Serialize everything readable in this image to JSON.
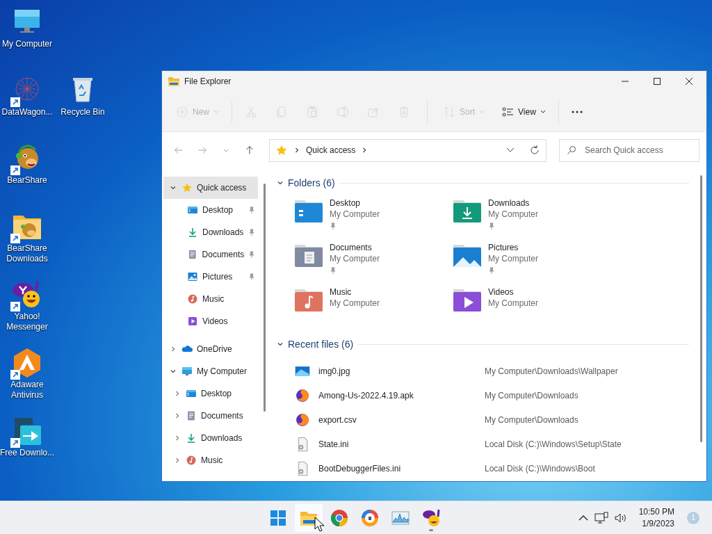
{
  "desktop_icons": [
    {
      "label": "My Computer",
      "kind": "monitor",
      "shortcut": false
    },
    {
      "label": "DataWagon...",
      "kind": "web",
      "shortcut": true
    },
    {
      "label": "Recycle Bin",
      "kind": "recycle",
      "shortcut": false
    },
    {
      "label": "BearShare",
      "kind": "bear",
      "shortcut": true
    },
    {
      "label": "BearShare Downloads",
      "kind": "bearfolder",
      "shortcut": true
    },
    {
      "label": "Yahoo! Messenger",
      "kind": "yahoo",
      "shortcut": true
    },
    {
      "label": "Adaware Antivirus",
      "kind": "adaware",
      "shortcut": true
    },
    {
      "label": "Free Downlo...",
      "kind": "fdm",
      "shortcut": true
    }
  ],
  "window": {
    "title": "File Explorer",
    "toolbar": [
      {
        "kind": "new",
        "label": "New",
        "disabled": true,
        "dropdown": true
      },
      {
        "kind": "sep"
      },
      {
        "kind": "cut",
        "disabled": true
      },
      {
        "kind": "copy",
        "disabled": true
      },
      {
        "kind": "paste",
        "disabled": true
      },
      {
        "kind": "rename",
        "disabled": true
      },
      {
        "kind": "share",
        "disabled": true
      },
      {
        "kind": "delete",
        "disabled": true
      },
      {
        "kind": "sep"
      },
      {
        "kind": "sort",
        "label": "Sort",
        "disabled": true,
        "dropdown": true
      },
      {
        "kind": "view",
        "label": "View",
        "disabled": false,
        "dropdown": true
      },
      {
        "kind": "sep"
      },
      {
        "kind": "more",
        "disabled": false
      }
    ],
    "nav_buttons": [
      {
        "kind": "back",
        "disabled": true
      },
      {
        "kind": "forward",
        "disabled": true
      },
      {
        "kind": "recent",
        "disabled": true
      },
      {
        "kind": "up",
        "disabled": false
      }
    ],
    "address": {
      "path": [
        "Quick access"
      ]
    },
    "search": {
      "placeholder": "Search Quick access"
    },
    "tree": [
      {
        "label": "Quick access",
        "kind": "star",
        "expanded": true,
        "selected": true,
        "children": [
          {
            "label": "Desktop",
            "kind": "desktop",
            "pinned": true,
            "selected": false
          },
          {
            "label": "Downloads",
            "kind": "downloads",
            "pinned": true,
            "selected": false
          },
          {
            "label": "Documents",
            "kind": "documents",
            "pinned": true,
            "selected": false
          },
          {
            "label": "Pictures",
            "kind": "pictures",
            "pinned": true,
            "selected": false
          },
          {
            "label": "Music",
            "kind": "music",
            "pinned": false,
            "selected": false
          },
          {
            "label": "Videos",
            "kind": "videos",
            "pinned": false,
            "selected": false
          }
        ]
      },
      {
        "label": "OneDrive",
        "kind": "onedrive",
        "expanded": false,
        "selected": false
      },
      {
        "label": "My Computer",
        "kind": "computer",
        "expanded": true,
        "selected": false,
        "children": [
          {
            "label": "Desktop",
            "kind": "desktop",
            "expanded": false,
            "selected": false
          },
          {
            "label": "Documents",
            "kind": "documents",
            "expanded": false,
            "selected": false
          },
          {
            "label": "Downloads",
            "kind": "downloads",
            "expanded": false,
            "selected": false
          },
          {
            "label": "Music",
            "kind": "music",
            "expanded": false,
            "selected": false
          }
        ]
      }
    ],
    "folders": {
      "title": "Folders (6)",
      "expanded": true,
      "items": [
        {
          "name": "Desktop",
          "location": "My Computer",
          "kind": "desktop",
          "pinned": true
        },
        {
          "name": "Downloads",
          "location": "My Computer",
          "kind": "downloads",
          "pinned": true
        },
        {
          "name": "Documents",
          "location": "My Computer",
          "kind": "documents",
          "pinned": true
        },
        {
          "name": "Pictures",
          "location": "My Computer",
          "kind": "pictures",
          "pinned": true
        },
        {
          "name": "Music",
          "location": "My Computer",
          "kind": "music",
          "pinned": false
        },
        {
          "name": "Videos",
          "location": "My Computer",
          "kind": "videos",
          "pinned": false
        }
      ]
    },
    "recent_files": {
      "title": "Recent files (6)",
      "expanded": true,
      "items": [
        {
          "name": "img0.jpg",
          "path": "My Computer\\Downloads\\Wallpaper",
          "kind": "image"
        },
        {
          "name": "Among-Us-2022.4.19.apk",
          "path": "My Computer\\Downloads",
          "kind": "browser"
        },
        {
          "name": "export.csv",
          "path": "My Computer\\Downloads",
          "kind": "browser"
        },
        {
          "name": "State.ini",
          "path": "Local Disk (C:)\\Windows\\Setup\\State",
          "kind": "settings"
        },
        {
          "name": "BootDebuggerFiles.ini",
          "path": "Local Disk (C:)\\Windows\\Boot",
          "kind": "settings"
        }
      ]
    }
  },
  "taskbar": {
    "apps": [
      {
        "kind": "start",
        "active": false,
        "running": false
      },
      {
        "kind": "explorer",
        "active": true,
        "running": false
      },
      {
        "kind": "chrome",
        "active": false,
        "running": false
      },
      {
        "kind": "shield",
        "active": false,
        "running": false
      },
      {
        "kind": "monitor",
        "active": false,
        "running": false
      },
      {
        "kind": "yahoo",
        "active": false,
        "running": true
      }
    ],
    "time": "10:50 PM",
    "date": "1/9/2023",
    "notifications": "1"
  }
}
